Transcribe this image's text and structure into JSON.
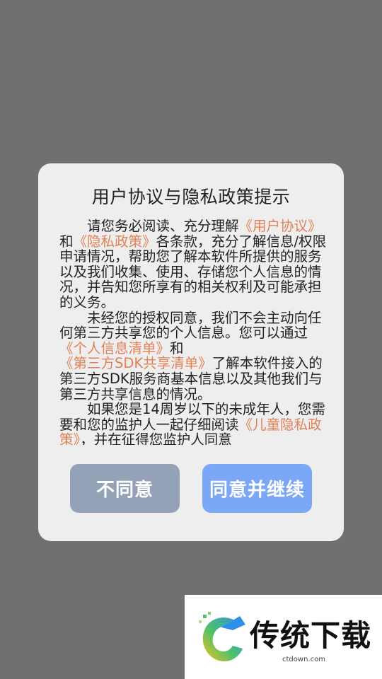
{
  "dialog": {
    "title": "用户协议与隐私政策提示",
    "paragraphs": [
      [
        {
          "text": "请您务必阅读、充分理解",
          "link": false
        },
        {
          "text": "《用户协议》",
          "link": true
        },
        {
          "text": "和",
          "link": false
        },
        {
          "text": "《隐私政策》",
          "link": true
        },
        {
          "text": "各条款，充分了解信息/权限申请情况，帮助您了解本软件所提供的服务以及我们收集、使用、存储您个人信息的情况，并告知您所享有的相关权利及可能承担的义务。",
          "link": false
        }
      ],
      [
        {
          "text": "未经您的授权同意，我们不会主动向任何第三方共享您的个人信息。您可以通过",
          "link": false
        },
        {
          "text": "《个人信息清单》",
          "link": true
        },
        {
          "text": "和",
          "link": false
        },
        {
          "text": "《第三方SDK共享清单》",
          "link": true
        },
        {
          "text": "了解本软件接入的第三方SDK服务商基本信息以及其他我们与第三方共享信息的情况。",
          "link": false
        }
      ],
      [
        {
          "text": "如果您是14周岁以下的未成年人，您需要和您的监护人一起仔细阅读",
          "link": false
        },
        {
          "text": "《儿童隐私政策》",
          "link": true
        },
        {
          "text": "，并在征得您监护人同意",
          "link": false
        }
      ]
    ],
    "disagree_label": "不同意",
    "agree_label": "同意并继续"
  },
  "watermark": {
    "brand_text": "传统下载",
    "url": "ctdown.com"
  },
  "colors": {
    "backdrop": "#707070",
    "dialog_bg": "#eeeeee",
    "link": "#e08256",
    "disagree_button": "#93a2b7",
    "agree_button": "#7ba7f7"
  }
}
